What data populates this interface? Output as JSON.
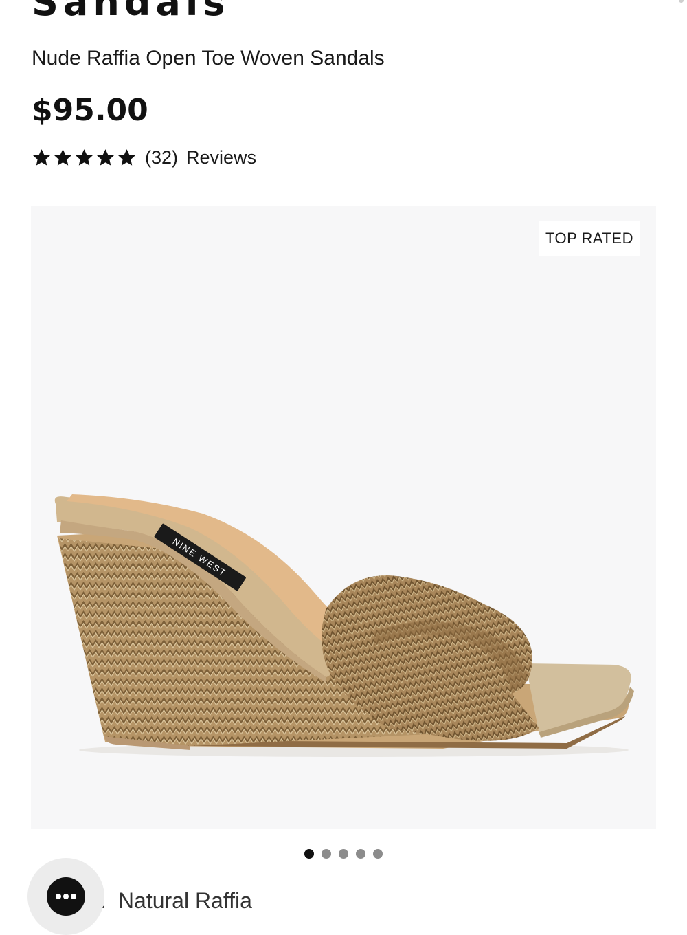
{
  "product": {
    "title_fragment": "Sandals",
    "subtitle": "Nude Raffia Open Toe Woven Sandals",
    "price": "$95.00",
    "rating": {
      "stars": 5,
      "count": "(32)",
      "reviews_label": "Reviews"
    }
  },
  "gallery": {
    "badge": "TOP RATED",
    "image_icon": "raffia-wedge-sandal-image",
    "insole_label": "NINE WEST",
    "slide_count": 5,
    "active_slide": 1
  },
  "selection": {
    "color_label_fragment": ":",
    "color_value": "Natural Raffia"
  },
  "chat": {
    "icon": "chat-ellipsis-icon"
  },
  "colors": {
    "text": "#111111",
    "gallery_bg": "#f7f7f8",
    "dot_inactive": "#8c8c8c",
    "raffia": "#b59466"
  }
}
